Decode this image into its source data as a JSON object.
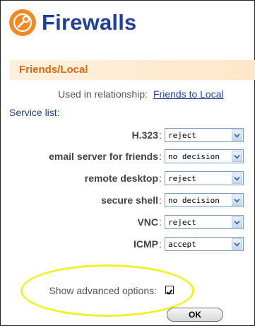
{
  "app": {
    "title": "Firewalls"
  },
  "section": {
    "title": "Friends/Local"
  },
  "relationship": {
    "label": "Used in relationship:",
    "value": "Friends to Local"
  },
  "service_list": {
    "label": "Service list:",
    "items": [
      {
        "name": "H.323",
        "value": "reject"
      },
      {
        "name": "email server for friends",
        "value": "no decision"
      },
      {
        "name": "remote desktop",
        "value": "reject"
      },
      {
        "name": "secure shell",
        "value": "no decision"
      },
      {
        "name": "VNC",
        "value": "reject"
      },
      {
        "name": "ICMP",
        "value": "accept"
      }
    ]
  },
  "advanced": {
    "label": "Show advanced options:",
    "checked": true
  },
  "buttons": {
    "ok": "OK"
  },
  "colors": {
    "title_blue": "#1f3f99",
    "section_orange": "#d66a10",
    "logo_orange": "#f08a24",
    "highlight_yellow": "#f1f12a"
  },
  "icons": {
    "logo": "wrench-icon",
    "dropdown": "chevron-down-icon",
    "checkbox": "checkmark-icon"
  }
}
